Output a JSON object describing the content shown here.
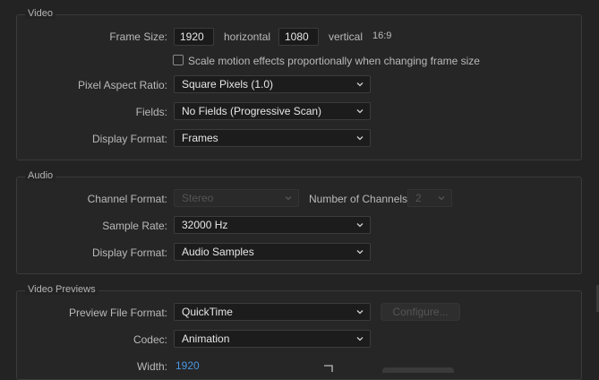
{
  "video": {
    "section_title": "Video",
    "frame_size_label": "Frame Size:",
    "width_value": "1920",
    "horizontal_label": "horizontal",
    "height_value": "1080",
    "vertical_label": "vertical",
    "aspect_ratio": "16:9",
    "scale_checkbox_label": "Scale motion effects proportionally when changing frame size",
    "scale_checked": false,
    "pixel_aspect_label": "Pixel Aspect Ratio:",
    "pixel_aspect_value": "Square Pixels (1.0)",
    "fields_label": "Fields:",
    "fields_value": "No Fields (Progressive Scan)",
    "display_format_label": "Display Format:",
    "display_format_value": "Frames"
  },
  "audio": {
    "section_title": "Audio",
    "channel_format_label": "Channel Format:",
    "channel_format_value": "Stereo",
    "num_channels_label": "Number of Channels:",
    "num_channels_value": "2",
    "sample_rate_label": "Sample Rate:",
    "sample_rate_value": "32000 Hz",
    "display_format_label": "Display Format:",
    "display_format_value": "Audio Samples"
  },
  "previews": {
    "section_title": "Video Previews",
    "file_format_label": "Preview File Format:",
    "file_format_value": "QuickTime",
    "configure_label": "Configure...",
    "codec_label": "Codec:",
    "codec_value": "Animation",
    "width_label": "Width:",
    "width_value": "1920"
  },
  "icons": {
    "dropdown": "chevron-down-icon",
    "link": "link-bracket-icon"
  },
  "colors": {
    "background": "#232323",
    "link_value": "#4a96e0"
  }
}
